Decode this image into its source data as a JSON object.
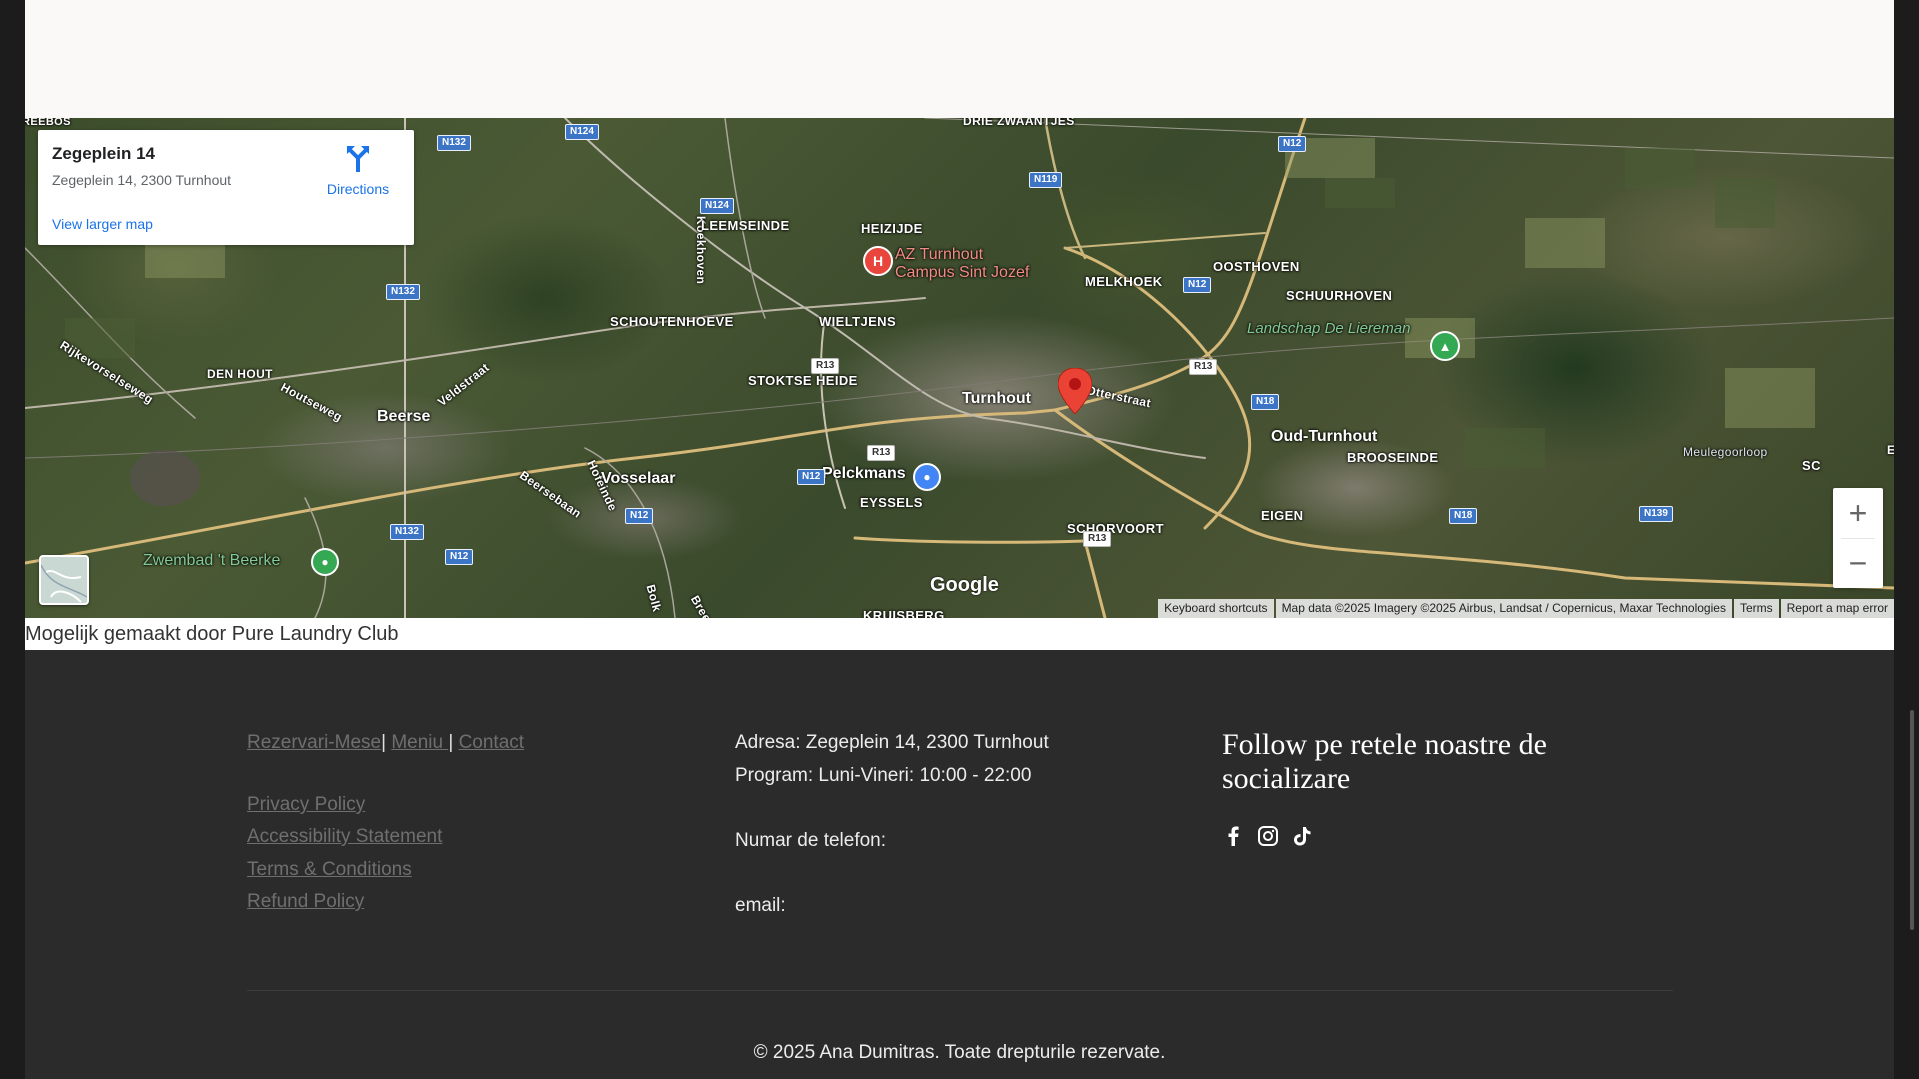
{
  "map": {
    "info_card": {
      "title": "Zegeplein 14",
      "address": "Zegeplein 14, 2300 Turnhout",
      "directions_label": "Directions",
      "larger_map_label": "View larger map"
    },
    "labels": {
      "reebos": "REEBOS",
      "drie_zwaantjes": "DRIE ZWAANTJES",
      "leemseinde": "LEEMSEINDE",
      "heizijde": "HEIZIJDE",
      "az_line1": "AZ Turnhout",
      "az_line2": "Campus Sint Jozef",
      "oosthoven": "OOSTHOVEN",
      "schuurhoven": "SCHUURHOVEN",
      "melkhoek": "MELKHOEK",
      "lieremans": "Landschap De Liereman",
      "rijkevorselseweg": "Rijkevorselseweg",
      "veldstraat": "Veldstraat",
      "schoutenhoeve": "SCHOUTENHOEVE",
      "wieltjens": "WIELTJENS",
      "stoktse_heide": "STOKTSE HEIDE",
      "den_hout": "DEN HOUT",
      "houtseweg": "Houtseweg",
      "beerse": "Beerse",
      "turnhout": "Turnhout",
      "otterstraat": "Otterstraat",
      "oud_turnhout": "Oud-Turnhout",
      "brooseinde": "BROOSEINDE",
      "meulegoorloop": "Meulegoorloop",
      "beersebaan": "Beersebaan",
      "hofeinde": "Hofeinde",
      "vosselaar": "Vosselaar",
      "pelckmans": "Pelckmans",
      "eyssels": "EYSSELS",
      "eigen": "EIGEN",
      "schorvoort": "SCHORVOORT",
      "zwembad": "Zwembad 't Beerke",
      "kruisberg": "KRUISBERG",
      "koekhoven": "Koekhoven",
      "sc": "SC",
      "e": "E",
      "bolk": "Bolk",
      "bree": "Bree"
    },
    "shields": {
      "n132a": "N132",
      "n124a": "N124",
      "n124b": "N124",
      "n132b": "N132",
      "n132c": "N132",
      "n119": "N119",
      "n12a": "N12",
      "n12b": "N12",
      "n12c": "N12",
      "n12d": "N12",
      "n12e": "N12",
      "r13a": "R13",
      "r13b": "R13",
      "r13c": "R13",
      "r13d": "R13",
      "n18a": "N18",
      "n18b": "N18",
      "n139": "N139"
    },
    "google_logo": "Google",
    "attribution": {
      "keyboard": "Keyboard shortcuts",
      "mapdata": "Map data ©2025 Imagery ©2025 Airbus, Landsat / Copernicus, Maxar Technologies",
      "terms": "Terms",
      "report": "Report a map error"
    },
    "pin_color": "#ea4335"
  },
  "caption": "Mogelijk gemaakt door Pure Laundry Club",
  "footer": {
    "nav": {
      "rezervari": "Rezervari-Mese",
      "meniu": "Meniu ",
      "contact": "Contact",
      "sep1": "|",
      "sep2": " |"
    },
    "policies": {
      "privacy": "Privacy Policy",
      "accessibility": "Accessibility Statement",
      "terms": "Terms & Conditions",
      "refund": "Refund Policy"
    },
    "info": {
      "address": "Adresa: Zegeplein 14, 2300 Turnhout",
      "program": "Program: Luni-Vineri: 10:00 - 22:00",
      "phone": "Numar de telefon:",
      "email": "email:"
    },
    "follow_title": "Follow pe retele noastre de socializare",
    "social_icons": [
      "facebook-icon",
      "instagram-icon",
      "tiktok-icon"
    ],
    "copyright": "© 2025 Ana Dumitras. Toate drepturile rezervate."
  }
}
